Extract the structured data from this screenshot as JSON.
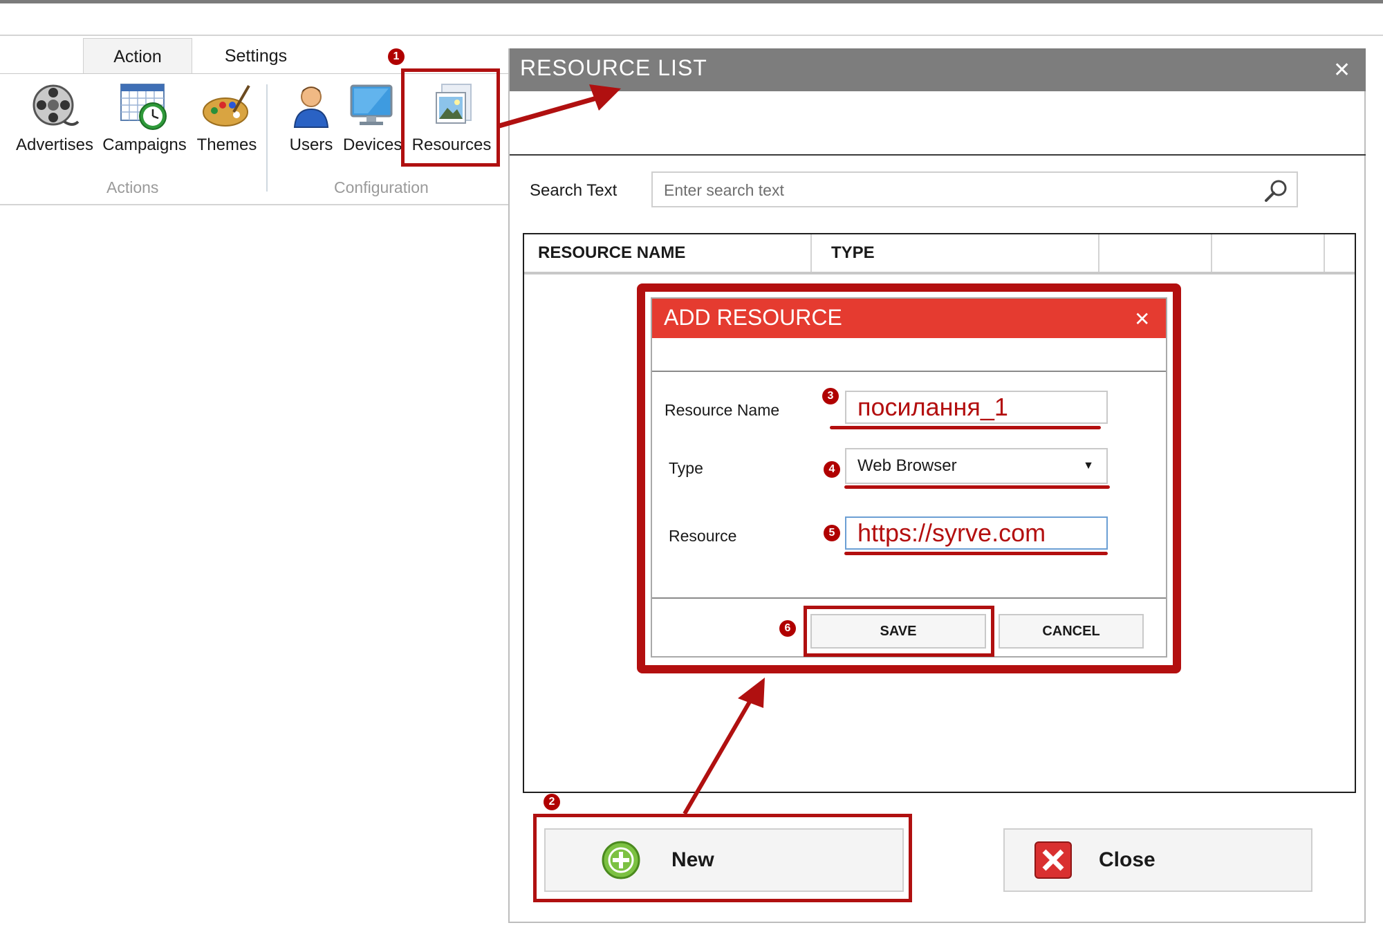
{
  "ribbon": {
    "tabs": [
      {
        "label": "Action",
        "active": true
      },
      {
        "label": "Settings",
        "active": false
      }
    ],
    "groups": [
      {
        "label": "Actions",
        "items": [
          {
            "label": "Advertises",
            "icon": "film-reel-icon"
          },
          {
            "label": "Campaigns",
            "icon": "calendar-clock-icon"
          },
          {
            "label": "Themes",
            "icon": "paint-palette-icon"
          }
        ]
      },
      {
        "label": "Configuration",
        "items": [
          {
            "label": "Users",
            "icon": "user-icon"
          },
          {
            "label": "Devices",
            "icon": "monitor-icon"
          },
          {
            "label": "Resources",
            "icon": "picture-icon"
          }
        ]
      }
    ]
  },
  "resource_list": {
    "title": "RESOURCE LIST",
    "search_label": "Search Text",
    "search_placeholder": "Enter search text",
    "columns": [
      "RESOURCE NAME",
      "TYPE",
      "",
      ""
    ],
    "buttons": {
      "new": "New",
      "close": "Close"
    }
  },
  "add_resource": {
    "title": "ADD RESOURCE",
    "fields": {
      "name_label": "Resource Name",
      "name_value": "посилання_1",
      "type_label": "Type",
      "type_value": "Web Browser",
      "resource_label": "Resource",
      "resource_value": "https://syrve.com"
    },
    "buttons": {
      "save": "SAVE",
      "cancel": "CANCEL"
    }
  },
  "markers": [
    "1",
    "2",
    "3",
    "4",
    "5",
    "6"
  ],
  "colors": {
    "annotation_red": "#b01010",
    "dialog_title_red": "#e53b30",
    "window_title_gray": "#7d7d7d"
  }
}
